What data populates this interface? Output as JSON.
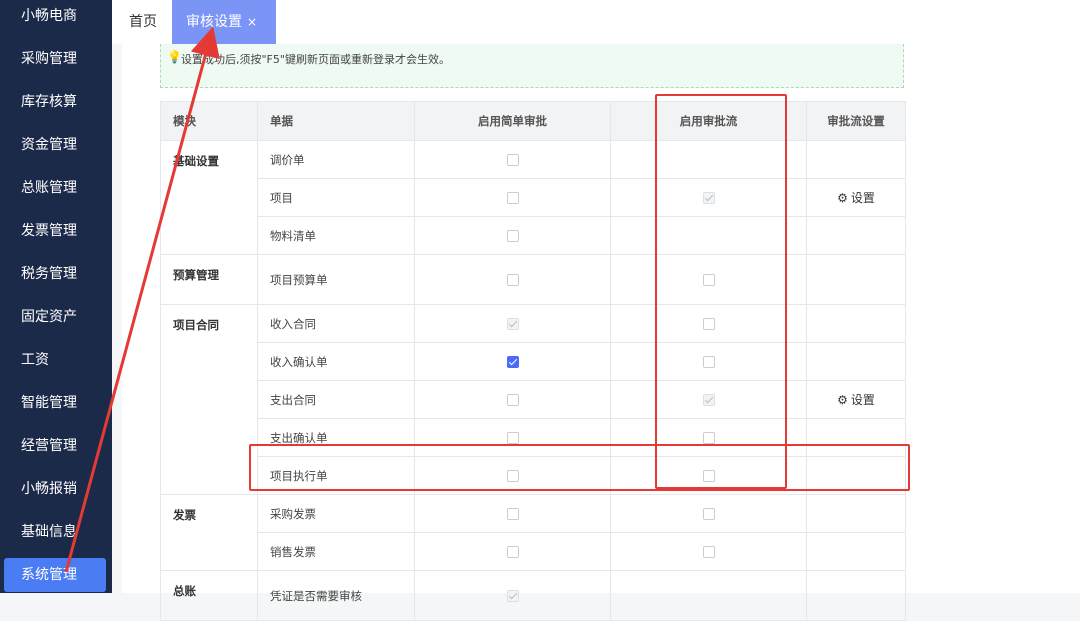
{
  "sidebar": {
    "items": [
      {
        "label": "小畅电商"
      },
      {
        "label": "采购管理"
      },
      {
        "label": "库存核算"
      },
      {
        "label": "资金管理"
      },
      {
        "label": "总账管理"
      },
      {
        "label": "发票管理"
      },
      {
        "label": "税务管理"
      },
      {
        "label": "固定资产"
      },
      {
        "label": "工资"
      },
      {
        "label": "智能管理"
      },
      {
        "label": "经营管理"
      },
      {
        "label": "小畅报销"
      },
      {
        "label": "基础信息"
      },
      {
        "label": "系统管理"
      }
    ]
  },
  "tabs": {
    "home": "首页",
    "active": "审核设置",
    "close": "×"
  },
  "tip": {
    "text": "设置成功后,须按\"F5\"键刷新页面或重新登录才会生效。"
  },
  "table": {
    "headers": [
      "模块",
      "单据",
      "启用简单审批",
      "启用审批流",
      "审批流设置"
    ],
    "modules": {
      "m1": "基础设置",
      "m2": "预算管理",
      "m3": "项目合同",
      "m4": "发票",
      "m5": "总账"
    },
    "rows": [
      {
        "doc": "调价单"
      },
      {
        "doc": "项目",
        "setting": "设置"
      },
      {
        "doc": "物料清单"
      },
      {
        "doc": "项目预算单"
      },
      {
        "doc": "收入合同"
      },
      {
        "doc": "收入确认单"
      },
      {
        "doc": "支出合同",
        "setting": "设置"
      },
      {
        "doc": "支出确认单"
      },
      {
        "doc": "项目执行单"
      },
      {
        "doc": "采购发票"
      },
      {
        "doc": "销售发票"
      },
      {
        "doc": "凭证是否需要审核"
      }
    ]
  },
  "colors": {
    "sidebar_bg": "#1c2a4a",
    "active_nav": "#4a7cf3",
    "active_tab": "#7b95f7",
    "checkbox_checked": "#4a6cf7",
    "annotation_red": "#e53935"
  }
}
